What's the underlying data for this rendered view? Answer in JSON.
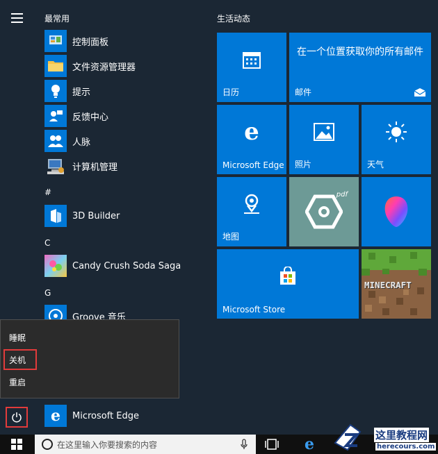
{
  "sections": {
    "most_used": "最常用",
    "hash": "#",
    "c": "C",
    "g": "G"
  },
  "apps": [
    {
      "label": "控制面板",
      "icon": "control-panel-icon"
    },
    {
      "label": "文件资源管理器",
      "icon": "folder-icon"
    },
    {
      "label": "提示",
      "icon": "lightbulb-icon"
    },
    {
      "label": "反馈中心",
      "icon": "feedback-icon"
    },
    {
      "label": "人脉",
      "icon": "people-icon"
    },
    {
      "label": "计算机管理",
      "icon": "computer-management-icon"
    },
    {
      "label": "3D Builder",
      "icon": "3d-builder-icon"
    },
    {
      "label": "Candy Crush Soda Saga",
      "icon": "candy-crush-icon"
    },
    {
      "label": "Groove 音乐",
      "icon": "groove-music-icon"
    },
    {
      "label": "Microsoft Edge",
      "icon": "edge-icon"
    }
  ],
  "power_menu": {
    "sleep": "睡眠",
    "shutdown": "关机",
    "restart": "重启"
  },
  "tiles": {
    "group_title": "生活动态",
    "calendar": "日历",
    "mail_heading": "在一个位置获取你的所有邮件",
    "mail": "邮件",
    "edge": "Microsoft Edge",
    "photos": "照片",
    "weather": "天气",
    "maps": "地图",
    "store": "Microsoft Store",
    "pdf_logo": "pdf",
    "minecraft_logo": "MINECRAFT"
  },
  "taskbar": {
    "search_placeholder": "在这里输入你要搜索的内容"
  },
  "watermark": {
    "line1": "这里教程网",
    "line2": "herecours.com"
  },
  "colors": {
    "tile_blue": "#0078d7",
    "background": "#1b2734",
    "highlight": "#e23b3b"
  }
}
